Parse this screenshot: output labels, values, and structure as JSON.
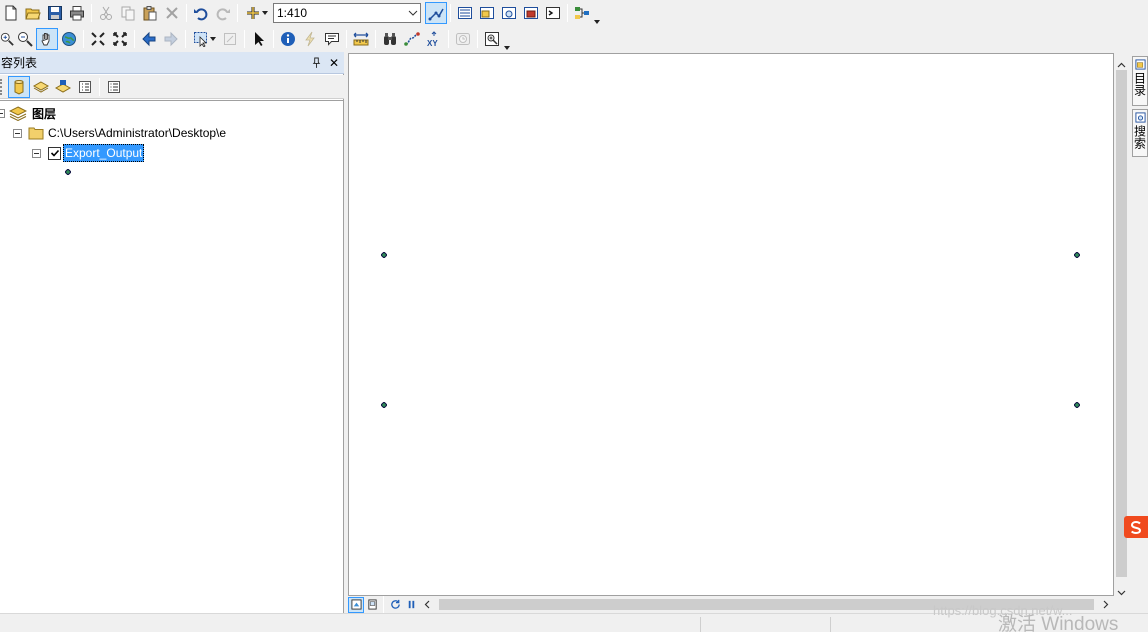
{
  "toolbar": {
    "scale_value": "1:410"
  },
  "toc": {
    "title": "容列表",
    "pin_label": "⊥",
    "close_label": "✕",
    "layers_root": "图层",
    "folder_path": "C:\\Users\\Administrator\\Desktop\\e",
    "layer_name": "Export_Output",
    "layer_checked": true
  },
  "right_dock": {
    "catalog_label": "目录",
    "search_label": "搜索"
  },
  "watermark": {
    "url": "https://blog.csdn.net/w...",
    "activate": "激活 Windows"
  },
  "colors": {
    "selection": "#3399ff",
    "point_fill": "#2e8b57",
    "panel_title": "#dbe6f4",
    "sogou_brand": "#f04a1e"
  },
  "icons": {
    "toolbar1": [
      "new-document-icon",
      "open-folder-icon",
      "save-icon",
      "print-icon",
      "cut-icon",
      "copy-icon",
      "paste-icon",
      "delete-icon",
      "undo-icon",
      "redo-icon",
      "add-data-icon",
      "scale-dropdown",
      "editor-toolbar-icon",
      "table-of-contents-icon",
      "catalog-window-icon",
      "search-window-icon",
      "arctoolbox-icon",
      "python-window-icon",
      "model-builder-icon"
    ],
    "toolbar2": [
      "zoom-in-icon",
      "zoom-out-icon",
      "pan-icon",
      "full-extent-icon",
      "fixed-zoom-in-icon",
      "fixed-zoom-out-icon",
      "back-extent-icon",
      "forward-extent-icon",
      "select-features-icon",
      "clear-selection-icon",
      "select-elements-icon",
      "identify-icon",
      "hyperlink-icon",
      "html-popup-icon",
      "measure-icon",
      "find-icon",
      "find-route-icon",
      "goto-xy-icon",
      "time-slider-icon",
      "create-viewer-icon"
    ]
  }
}
